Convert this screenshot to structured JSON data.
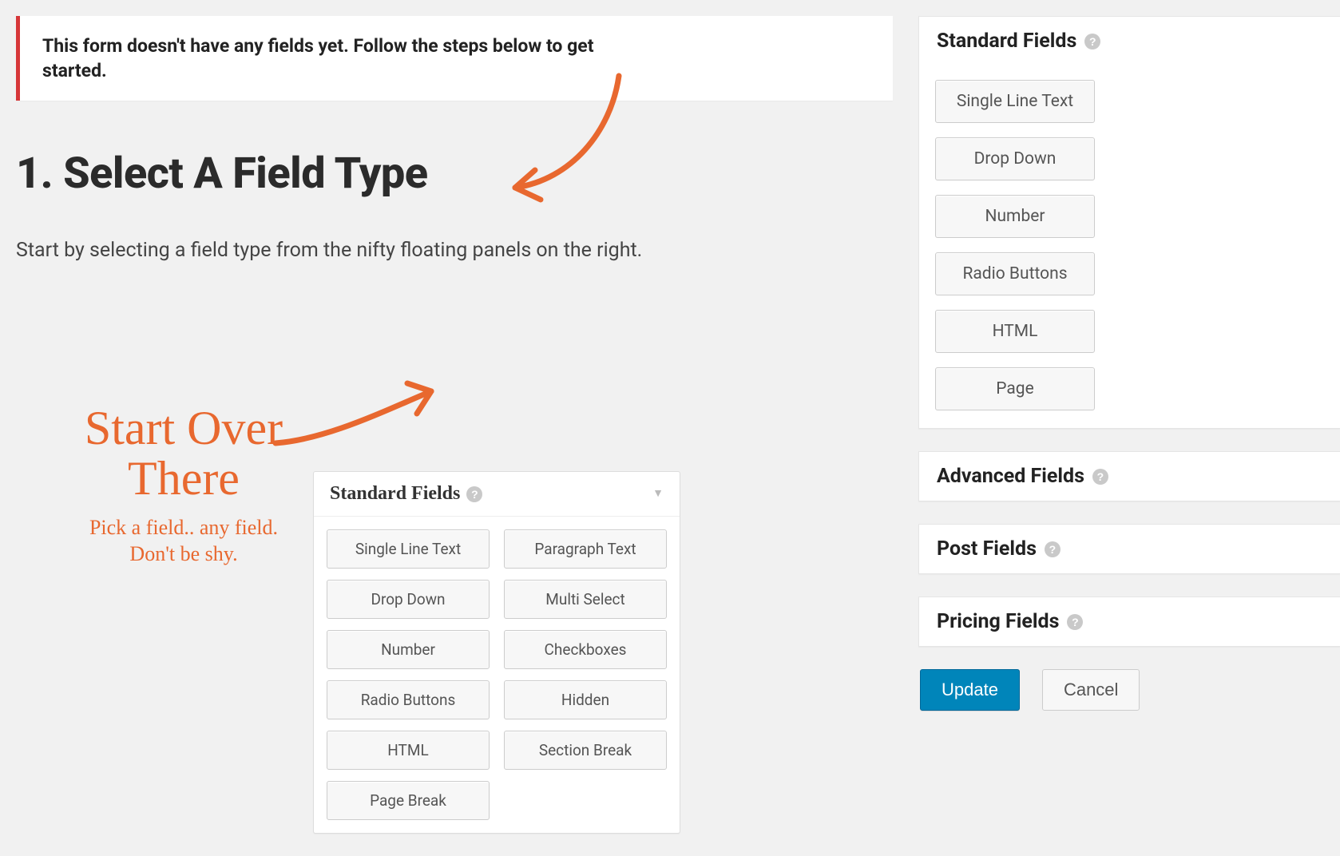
{
  "notice": {
    "text": "This form doesn't have any fields yet. Follow the steps below to get started."
  },
  "step": {
    "heading": "1. Select A Field Type",
    "description": "Start by selecting a field type from the nifty floating panels on the right."
  },
  "annotation": {
    "line1": "Start Over",
    "line2": "There",
    "sub1": "Pick a field.. any field.",
    "sub2": "Don't be shy."
  },
  "demo_panel": {
    "title": "Standard Fields",
    "buttons_left": [
      "Single Line Text",
      "Drop Down",
      "Number",
      "Radio Buttons",
      "HTML",
      "Page Break"
    ],
    "buttons_right": [
      "Paragraph Text",
      "Multi Select",
      "Checkboxes",
      "Hidden",
      "Section Break"
    ]
  },
  "sidebar": {
    "standard": {
      "title": "Standard Fields",
      "buttons": [
        "Single Line Text",
        "Drop Down",
        "Number",
        "Radio Buttons",
        "HTML",
        "Page"
      ]
    },
    "advanced": {
      "title": "Advanced Fields"
    },
    "post": {
      "title": "Post Fields"
    },
    "pricing": {
      "title": "Pricing Fields"
    },
    "actions": {
      "update": "Update",
      "cancel": "Cancel"
    }
  },
  "colors": {
    "accent": "#e8682f",
    "primary": "#0085ba",
    "error": "#d63638"
  }
}
